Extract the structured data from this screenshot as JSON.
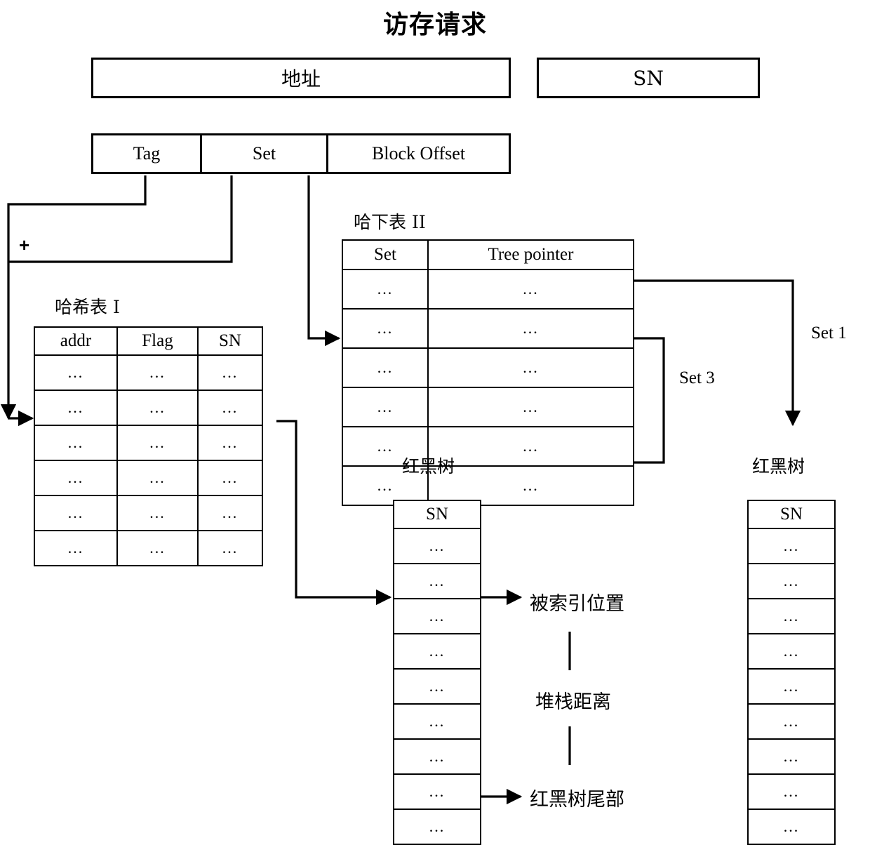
{
  "title": "访存请求",
  "top_bars": {
    "address": "地址",
    "sn": "SN"
  },
  "address_fields": {
    "tag": "Tag",
    "set": "Set",
    "block_offset": "Block Offset"
  },
  "operator": {
    "plus": "+"
  },
  "hash_table_1": {
    "caption": "哈希表 I",
    "columns": [
      "addr",
      "Flag",
      "SN"
    ],
    "rows": [
      [
        "...",
        "...",
        "..."
      ],
      [
        "...",
        "...",
        "..."
      ],
      [
        "...",
        "...",
        "..."
      ],
      [
        "...",
        "...",
        "..."
      ],
      [
        "...",
        "...",
        "..."
      ],
      [
        "...",
        "...",
        "..."
      ]
    ]
  },
  "hash_table_2": {
    "caption": "哈下表 II",
    "columns": [
      "Set",
      "Tree pointer"
    ],
    "rows": [
      [
        "...",
        "..."
      ],
      [
        "...",
        "..."
      ],
      [
        "...",
        "..."
      ],
      [
        "...",
        "..."
      ],
      [
        "...",
        "..."
      ],
      [
        "...",
        "..."
      ]
    ]
  },
  "rb_tree_left": {
    "caption": "红黑树",
    "column": "SN",
    "rows": [
      "...",
      "...",
      "...",
      "...",
      "...",
      "...",
      "...",
      "...",
      "..."
    ]
  },
  "rb_tree_right": {
    "caption": "红黑树",
    "column": "SN",
    "rows": [
      "...",
      "...",
      "...",
      "...",
      "...",
      "...",
      "...",
      "...",
      "..."
    ]
  },
  "edge_labels": {
    "set1": "Set 1",
    "set3": "Set 3"
  },
  "annotations": {
    "indexed_position": "被索引位置",
    "stack_distance": "堆栈距离",
    "rb_tree_tail": "红黑树尾部"
  },
  "colors": {
    "line": "#000000",
    "background": "#ffffff"
  }
}
